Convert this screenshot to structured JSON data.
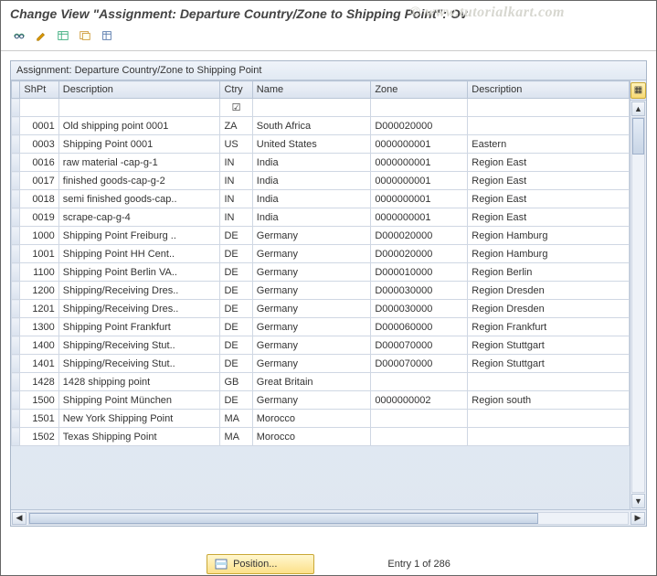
{
  "title": "Change View \"Assignment: Departure Country/Zone to Shipping Point\": Ov",
  "watermark": "© www.tutorialkart.com",
  "toolbar": {
    "undo": "toggle-change-mode",
    "edit": "edit-entry",
    "new": "new-entries",
    "copy": "copy-as",
    "delete": "delete"
  },
  "panel_title": "Assignment: Departure Country/Zone to Shipping Point",
  "columns": {
    "shpt": "ShPt",
    "desc1": "Description",
    "ctry": "Ctry",
    "name": "Name",
    "zone": "Zone",
    "desc2": "Description"
  },
  "filter_ctry_glyph": "☑",
  "rows": [
    {
      "shpt": "0001",
      "desc1": "Old shipping point 0001",
      "ctry": "ZA",
      "name": "South Africa",
      "zone": "D000020000",
      "desc2": ""
    },
    {
      "shpt": "0003",
      "desc1": "Shipping Point 0001",
      "ctry": "US",
      "name": "United States",
      "zone": "0000000001",
      "desc2": "Eastern"
    },
    {
      "shpt": "0016",
      "desc1": "raw material -cap-g-1",
      "ctry": "IN",
      "name": "India",
      "zone": "0000000001",
      "desc2": "Region East"
    },
    {
      "shpt": "0017",
      "desc1": "finished goods-cap-g-2",
      "ctry": "IN",
      "name": "India",
      "zone": "0000000001",
      "desc2": "Region East"
    },
    {
      "shpt": "0018",
      "desc1": "semi finished goods-cap..",
      "ctry": "IN",
      "name": "India",
      "zone": "0000000001",
      "desc2": "Region East"
    },
    {
      "shpt": "0019",
      "desc1": "scrape-cap-g-4",
      "ctry": "IN",
      "name": "India",
      "zone": "0000000001",
      "desc2": "Region East"
    },
    {
      "shpt": "1000",
      "desc1": "Shipping Point Freiburg ..",
      "ctry": "DE",
      "name": "Germany",
      "zone": "D000020000",
      "desc2": "Region Hamburg"
    },
    {
      "shpt": "1001",
      "desc1": "Shipping Point HH Cent..",
      "ctry": "DE",
      "name": "Germany",
      "zone": "D000020000",
      "desc2": "Region Hamburg"
    },
    {
      "shpt": "1100",
      "desc1": "Shipping Point Berlin VA..",
      "ctry": "DE",
      "name": "Germany",
      "zone": "D000010000",
      "desc2": "Region Berlin"
    },
    {
      "shpt": "1200",
      "desc1": "Shipping/Receiving Dres..",
      "ctry": "DE",
      "name": "Germany",
      "zone": "D000030000",
      "desc2": "Region Dresden"
    },
    {
      "shpt": "1201",
      "desc1": "Shipping/Receiving Dres..",
      "ctry": "DE",
      "name": "Germany",
      "zone": "D000030000",
      "desc2": "Region Dresden"
    },
    {
      "shpt": "1300",
      "desc1": "Shipping Point Frankfurt",
      "ctry": "DE",
      "name": "Germany",
      "zone": "D000060000",
      "desc2": "Region Frankfurt"
    },
    {
      "shpt": "1400",
      "desc1": "Shipping/Receiving Stut..",
      "ctry": "DE",
      "name": "Germany",
      "zone": "D000070000",
      "desc2": "Region Stuttgart"
    },
    {
      "shpt": "1401",
      "desc1": "Shipping/Receiving Stut..",
      "ctry": "DE",
      "name": "Germany",
      "zone": "D000070000",
      "desc2": "Region Stuttgart"
    },
    {
      "shpt": "1428",
      "desc1": "1428 shipping point",
      "ctry": "GB",
      "name": "Great Britain",
      "zone": "",
      "desc2": ""
    },
    {
      "shpt": "1500",
      "desc1": "Shipping Point München",
      "ctry": "DE",
      "name": "Germany",
      "zone": "0000000002",
      "desc2": "Region south"
    },
    {
      "shpt": "1501",
      "desc1": "New York Shipping Point",
      "ctry": "MA",
      "name": "Morocco",
      "zone": "",
      "desc2": ""
    },
    {
      "shpt": "1502",
      "desc1": "Texas Shipping Point",
      "ctry": "MA",
      "name": "Morocco",
      "zone": "",
      "desc2": ""
    }
  ],
  "footer": {
    "position_label": "Position...",
    "entry_text": "Entry 1 of 286"
  }
}
